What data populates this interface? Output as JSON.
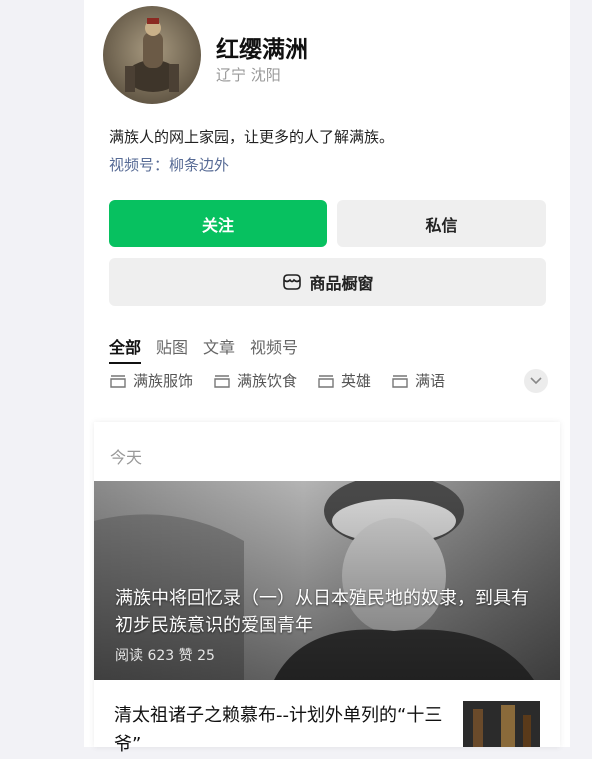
{
  "profile": {
    "name": "红缨满洲",
    "location": "辽宁 沈阳",
    "bio": "满族人的网上家园，让更多的人了解满族。",
    "channel": "视频号：柳条边外"
  },
  "actions": {
    "follow": "关注",
    "message": "私信",
    "shop": "商品橱窗"
  },
  "tabs": [
    "全部",
    "贴图",
    "文章",
    "视频号"
  ],
  "topics": [
    "满族服饰",
    "满族饮食",
    "英雄",
    "满语"
  ],
  "feed": {
    "date": "今天",
    "featured": {
      "title": "满族中将回忆录（一）从日本殖民地的奴隶，到具有初步民族意识的爱国青年",
      "stats": "阅读 623  赞 25"
    },
    "second": {
      "title": "清太祖诸子之赖慕布--计划外单列的“十三爷”"
    }
  },
  "colors": {
    "accent": "#07c160",
    "link": "#576b95",
    "page_bg": "#f2f2f6"
  }
}
